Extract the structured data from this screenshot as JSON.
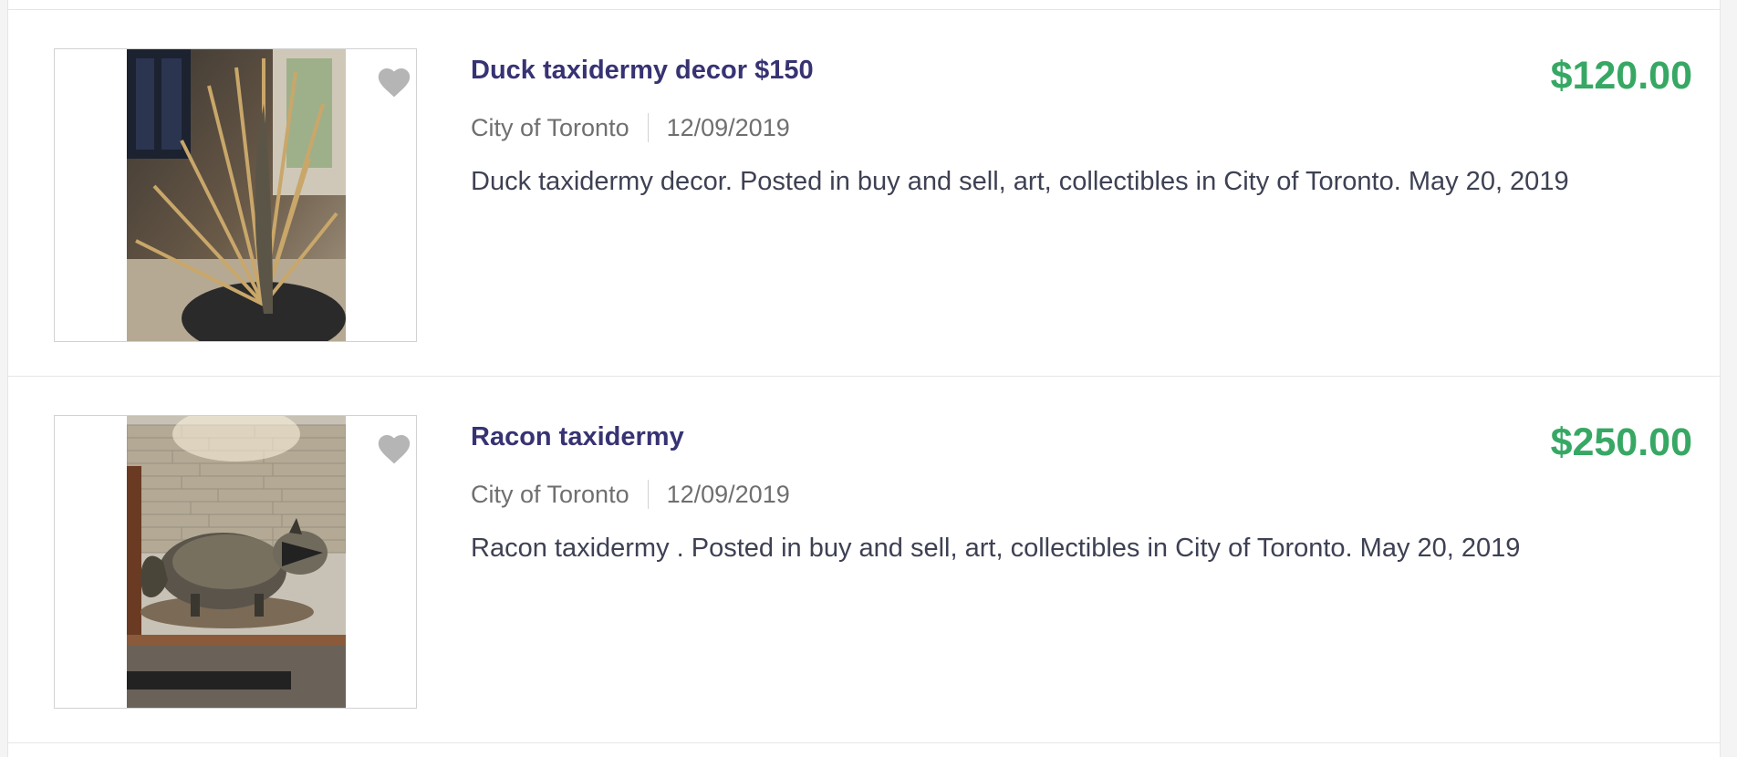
{
  "listings": [
    {
      "title": "Duck taxidermy decor $150",
      "location": "City of Toronto",
      "date": "12/09/2019",
      "description": "Duck taxidermy decor. Posted in buy and sell, art, collectibles in City of Toronto. May 20, 2019",
      "price": "$120.00",
      "image_alt": "Duck taxidermy decor photo",
      "favorite_icon": "heart-icon"
    },
    {
      "title": "Racon taxidermy",
      "location": "City of Toronto",
      "date": "12/09/2019",
      "description": "Racon taxidermy . Posted in buy and sell, art, collectibles in City of Toronto. May 20, 2019",
      "price": "$250.00",
      "image_alt": "Raccoon taxidermy photo",
      "favorite_icon": "heart-icon"
    }
  ],
  "colors": {
    "title": "#373373",
    "price": "#37a864",
    "meta": "#6f6f6f",
    "description": "#3e4153",
    "border": "#e6e6e6"
  }
}
